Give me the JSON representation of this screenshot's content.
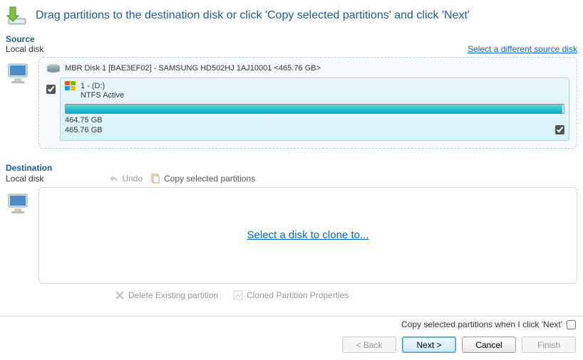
{
  "header": {
    "title": "Drag partitions to the destination disk or click 'Copy selected partitions' and click 'Next'"
  },
  "source": {
    "section_label": "Source",
    "subtype_label": "Local disk",
    "change_link": "Select a different source disk",
    "disk": {
      "title": "MBR Disk 1 [BAE3EF02] - SAMSUNG HD502HJ 1AJ10001  <465.76 GB>",
      "partition": {
        "name": "1 -  (D:)",
        "fs": "NTFS Active",
        "used": "464.75 GB",
        "total": "465.76 GB"
      }
    }
  },
  "destination": {
    "section_label": "Destination",
    "subtype_label": "Local disk",
    "undo_label": "Undo",
    "copy_label": "Copy selected partitions",
    "placeholder_link": "Select a disk to clone to...",
    "delete_label": "Delete Existing partition",
    "props_label": "Cloned Partition Properties"
  },
  "footer": {
    "auto_copy_label": "Copy selected partitions when I click 'Next'",
    "back": "< Back",
    "next": "Next >",
    "cancel": "Cancel",
    "finish": "Finish"
  }
}
